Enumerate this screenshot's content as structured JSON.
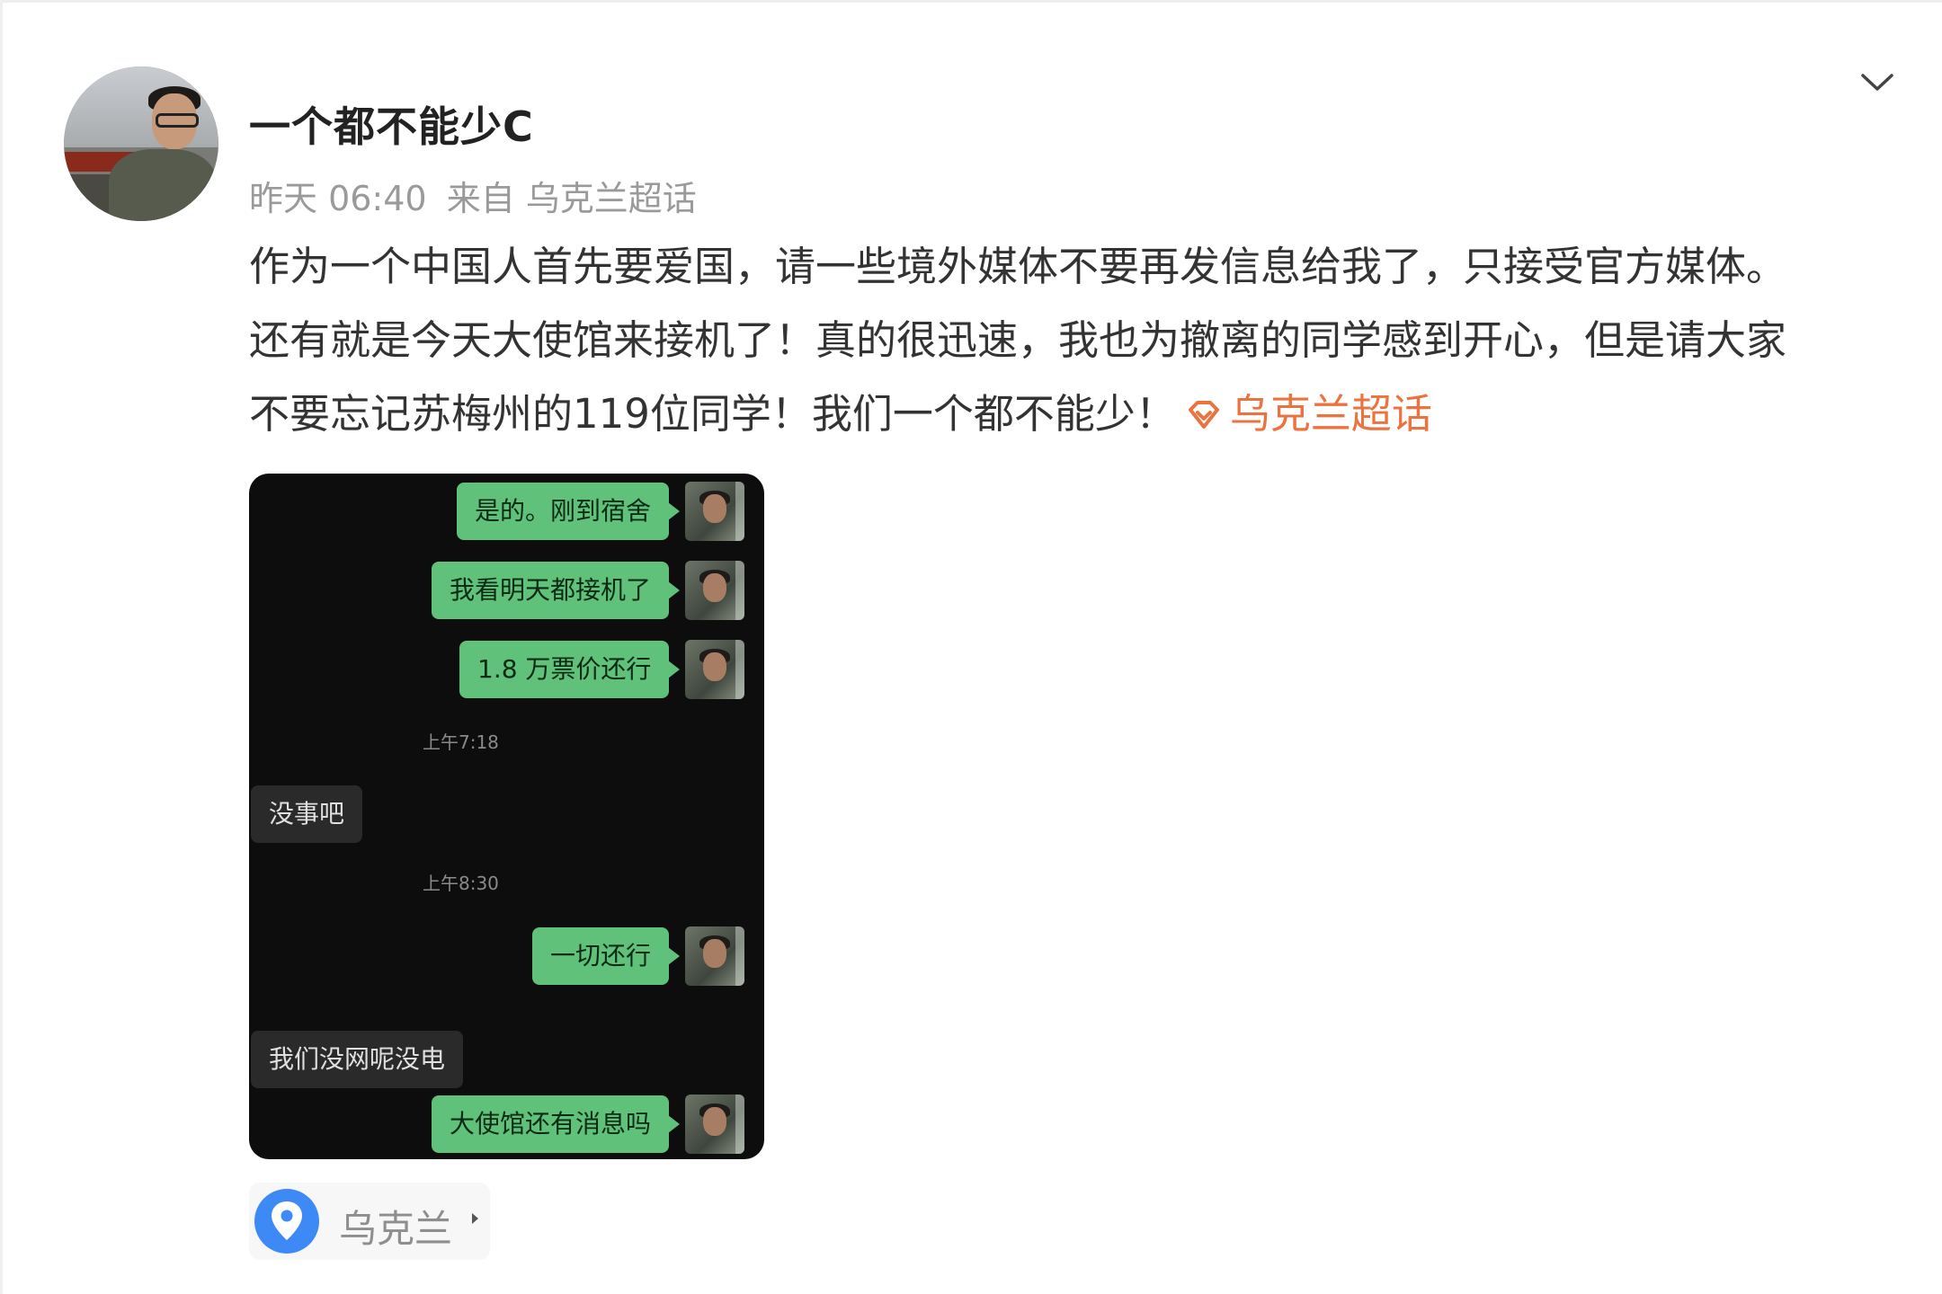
{
  "post": {
    "username": "一个都不能少C",
    "timestamp": "昨天 06:40",
    "source_prefix": "来自",
    "source": "乌克兰超话",
    "text_line1": "作为一个中国人首先要爱国，请一些境外媒体不要再发信息给我了，只接受官方媒体。",
    "text_line2": "还有就是今天大使馆来接机了！真的很迅速，我也为撤离的同学感到开心，但是请大家",
    "text_line3": "不要忘记苏梅州的119位同学！我们一个都不能少！",
    "topic_link": "乌克兰超话",
    "location": "乌克兰"
  },
  "chat": {
    "messages": [
      {
        "from": "me",
        "text": "是的。刚到宿舍"
      },
      {
        "from": "me",
        "text": "我看明天都接机了"
      },
      {
        "from": "me",
        "text": "1.8 万票价还行"
      },
      {
        "from": "time",
        "text": "上午7:18"
      },
      {
        "from": "other",
        "text": "没事吧"
      },
      {
        "from": "time",
        "text": "上午8:30"
      },
      {
        "from": "me",
        "text": "一切还行"
      },
      {
        "from": "other",
        "text": "我们没网呢没电"
      },
      {
        "from": "me",
        "text": "大使馆还有消息吗"
      }
    ]
  },
  "icons": {
    "expand": "chevron-down-icon",
    "topic": "super-topic-diamond-icon",
    "location": "location-pin-icon",
    "location_arrow": "caret-right-icon"
  },
  "colors": {
    "topic_link": "#eb7340",
    "location_pin": "#3d8af7",
    "chat_my_bubble": "#5fc17a",
    "chat_background": "#0d0d0d"
  }
}
